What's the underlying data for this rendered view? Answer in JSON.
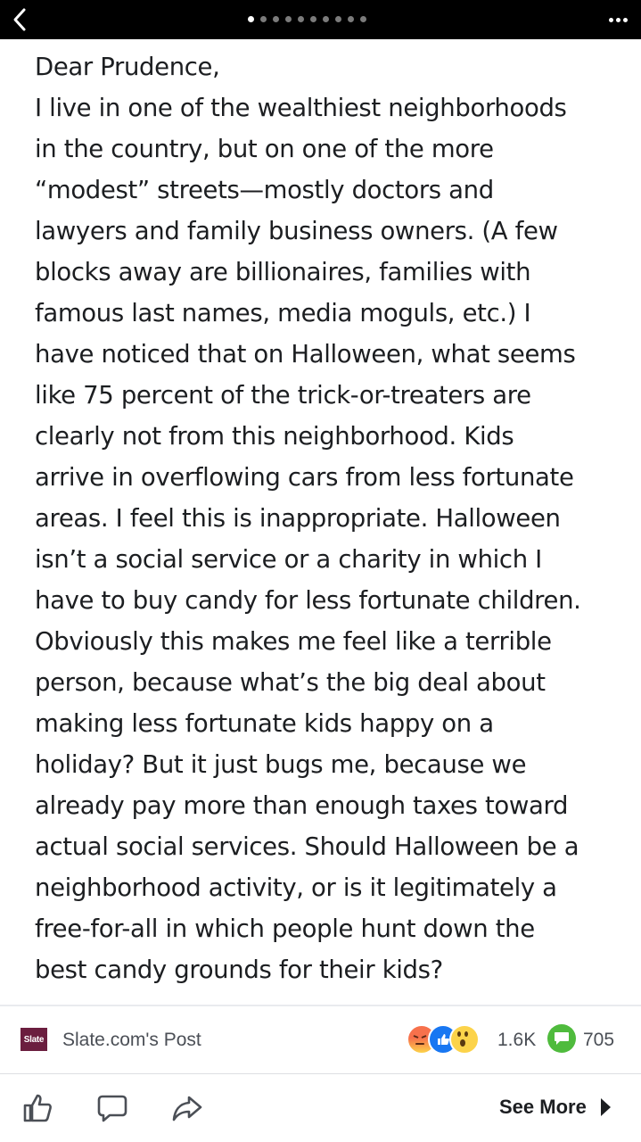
{
  "topbar": {
    "page_indicator": {
      "total": 10,
      "active": 0
    }
  },
  "letter": {
    "lines": [
      "Dear Prudence,",
      "I live in one of the wealthiest neighborhoods",
      "in the country, but on one of the more",
      "“modest” streets—mostly doctors and",
      "lawyers and family business owners. (A few",
      "blocks away are billionaires, families with",
      "famous last names, media moguls, etc.) I",
      "have noticed that on Halloween, what seems",
      "like 75 percent of the trick-or-treaters are",
      "clearly not from this neighborhood. Kids",
      "arrive in overflowing cars from less fortunate",
      "areas. I feel this is inappropriate. Halloween",
      "isn’t a social service or a charity in which I",
      "have to buy candy for less fortunate children.",
      "Obviously this makes me feel like a terrible",
      "person, because what’s the big deal about",
      "making less fortunate kids happy on a",
      "holiday? But it just bugs me, because we",
      "already pay more than enough taxes toward",
      "actual social services. Should Halloween be a",
      "neighborhood activity, or is it legitimately a",
      "free-for-all in which people hunt down the",
      "best candy grounds for their kids?"
    ]
  },
  "post": {
    "logo_text": "Slate",
    "title": "Slate.com's Post",
    "reaction_count": "1.6K",
    "comment_count": "705",
    "reaction_icons": [
      "angry-icon",
      "like-icon",
      "wow-icon"
    ]
  },
  "actions": {
    "see_more_label": "See More"
  },
  "colors": {
    "topbar_bg": "#000000",
    "slate_brand": "#6b1e3f",
    "like_blue": "#1877f2",
    "comment_green": "#4fbb3d"
  }
}
